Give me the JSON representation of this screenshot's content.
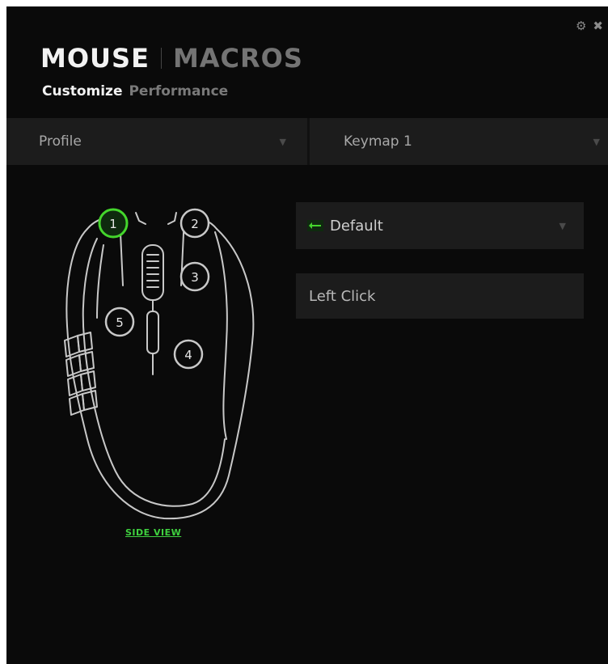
{
  "window": {
    "controls": {
      "settings_icon": "gear-icon",
      "close_icon": "close-icon"
    }
  },
  "main_tabs": [
    {
      "label": "MOUSE",
      "active": true
    },
    {
      "label": "MACROS",
      "active": false
    }
  ],
  "sub_tabs": [
    {
      "label": "Customize",
      "active": true
    },
    {
      "label": "Performance",
      "active": false
    }
  ],
  "topbar": {
    "profile_label": "Profile",
    "keymap_label": "Keymap 1"
  },
  "mouse": {
    "buttons": [
      {
        "number": "1",
        "selected": true
      },
      {
        "number": "2",
        "selected": false
      },
      {
        "number": "3",
        "selected": false
      },
      {
        "number": "4",
        "selected": false
      },
      {
        "number": "5",
        "selected": false
      }
    ],
    "side_view_link": "SIDE VIEW"
  },
  "assignment": {
    "mode_label": "Default",
    "action_label": "Left Click"
  },
  "colors": {
    "accent": "#44d62c",
    "background": "#0a0a0a",
    "panel": "#1c1c1c"
  }
}
